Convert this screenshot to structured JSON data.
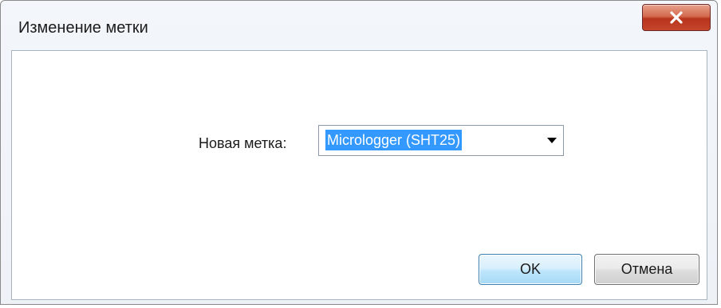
{
  "window": {
    "title": "Изменение метки"
  },
  "titlebar": {
    "close_icon": "close-x-icon",
    "close_color": "#c4462c"
  },
  "form": {
    "label": "Новая метка:",
    "combo": {
      "value": "Micrologger (SHT25)",
      "selected": true,
      "arrow_icon": "chevron-down-icon"
    }
  },
  "buttons": {
    "ok_label": "OK",
    "cancel_label": "Отмена"
  },
  "colors": {
    "selection": "#3399ff",
    "ok_border": "#3c7fb1"
  }
}
